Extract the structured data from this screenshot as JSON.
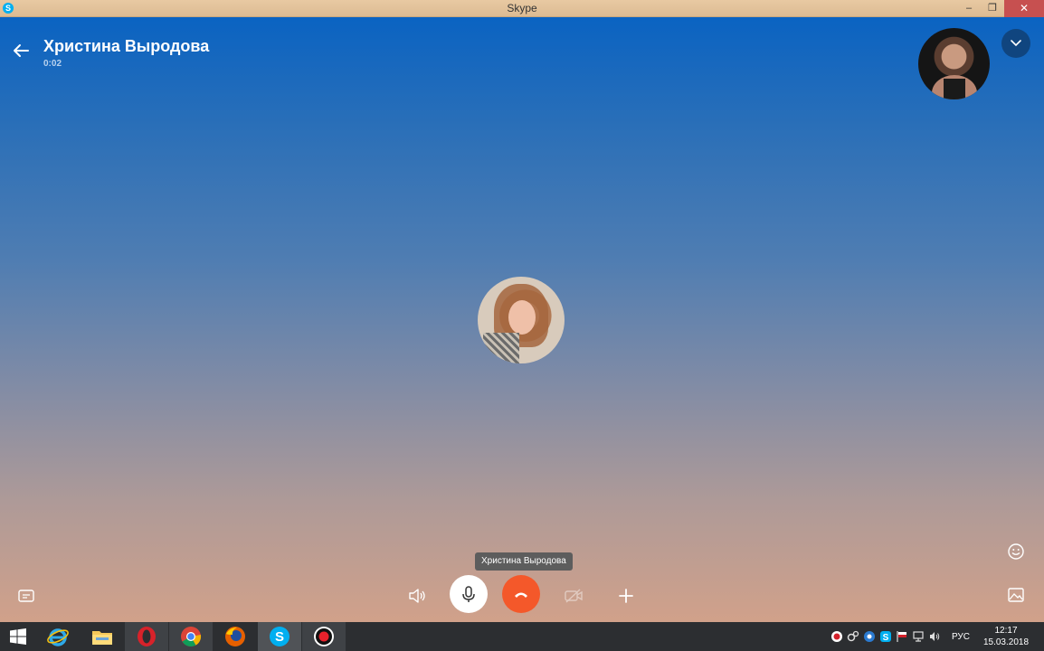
{
  "window": {
    "title": "Skype",
    "app_icon_glyph": "S",
    "minimize_glyph": "‒",
    "restore_glyph": "❐",
    "close_glyph": "✕"
  },
  "call": {
    "contact_name": "Христина Выродова",
    "timer": "0:02",
    "tooltip": "Христина Выродова",
    "background_top": "#0a63c2",
    "background_bottom": "#d1a18a",
    "hangup_color": "#f4582a"
  },
  "controls": [
    {
      "name": "chat-button",
      "icon": "chat-icon"
    },
    {
      "name": "speaker-button",
      "icon": "speaker-icon"
    },
    {
      "name": "mic-button",
      "icon": "microphone-icon"
    },
    {
      "name": "hangup-button",
      "icon": "phone-hangup-icon"
    },
    {
      "name": "video-button",
      "icon": "video-off-icon"
    },
    {
      "name": "add-button",
      "icon": "plus-icon"
    },
    {
      "name": "emoji-button",
      "icon": "smiley-icon"
    },
    {
      "name": "gallery-button",
      "icon": "image-icon"
    }
  ],
  "taskbar": {
    "apps": [
      {
        "name": "internet-explorer",
        "icon": "ie-icon"
      },
      {
        "name": "file-explorer",
        "icon": "folder-icon"
      },
      {
        "name": "opera",
        "icon": "opera-icon"
      },
      {
        "name": "chrome",
        "icon": "chrome-icon"
      },
      {
        "name": "firefox",
        "icon": "firefox-icon"
      },
      {
        "name": "skype",
        "icon": "skype-icon"
      },
      {
        "name": "recorder",
        "icon": "record-icon"
      }
    ],
    "language": "РУС",
    "time": "12:17",
    "date": "15.03.2018"
  }
}
